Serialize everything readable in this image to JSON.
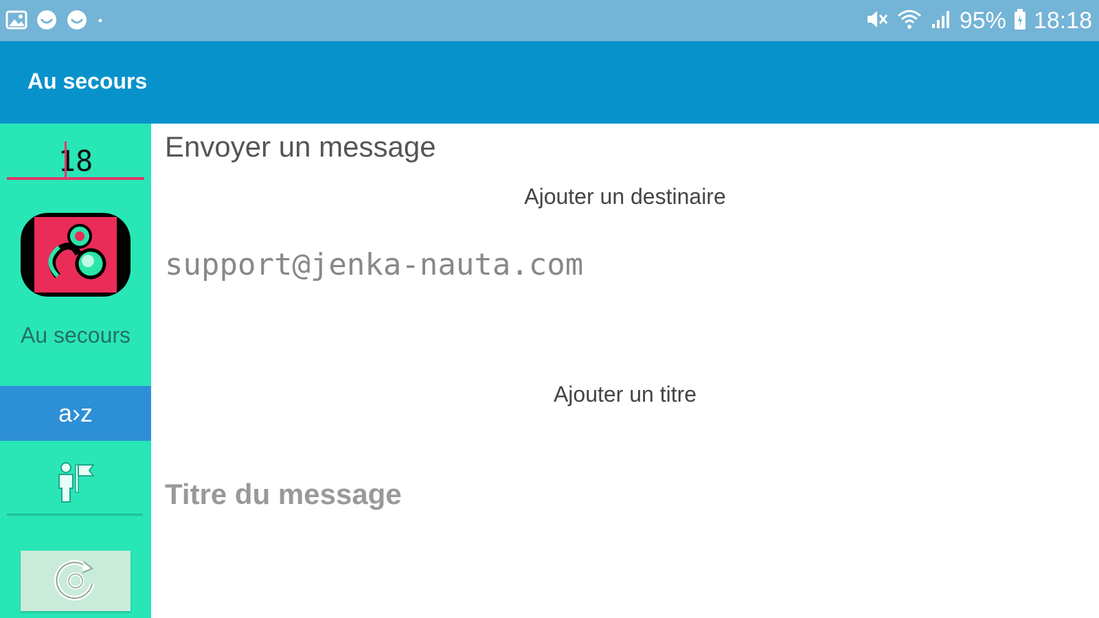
{
  "status_bar": {
    "battery_percent": "95%",
    "time": "18:18",
    "left_icons": [
      "image-icon",
      "smiley-icon",
      "smiley-icon",
      "dot-icon"
    ],
    "right_icons": [
      "mute-icon",
      "wifi-icon",
      "signal-icon",
      "battery-icon"
    ]
  },
  "app_bar": {
    "title": "Au secours"
  },
  "sidebar": {
    "number_value": "18",
    "app_label": "Au secours",
    "az_label": "a›z",
    "person_icon": "person-flag-icon",
    "refresh_icon": "refresh-icon"
  },
  "main": {
    "section_title": "Envoyer un message",
    "add_recipient_label": "Ajouter un destinaire",
    "email_value": "support@jenka-nauta.com",
    "add_title_label": "Ajouter un titre",
    "title_placeholder": "Titre du message"
  },
  "colors": {
    "status_bar": "#74b4d6",
    "app_bar": "#0892cc",
    "sidebar": "#29e6b6",
    "accent": "#e0366a",
    "az_button": "#2d8fd6"
  }
}
